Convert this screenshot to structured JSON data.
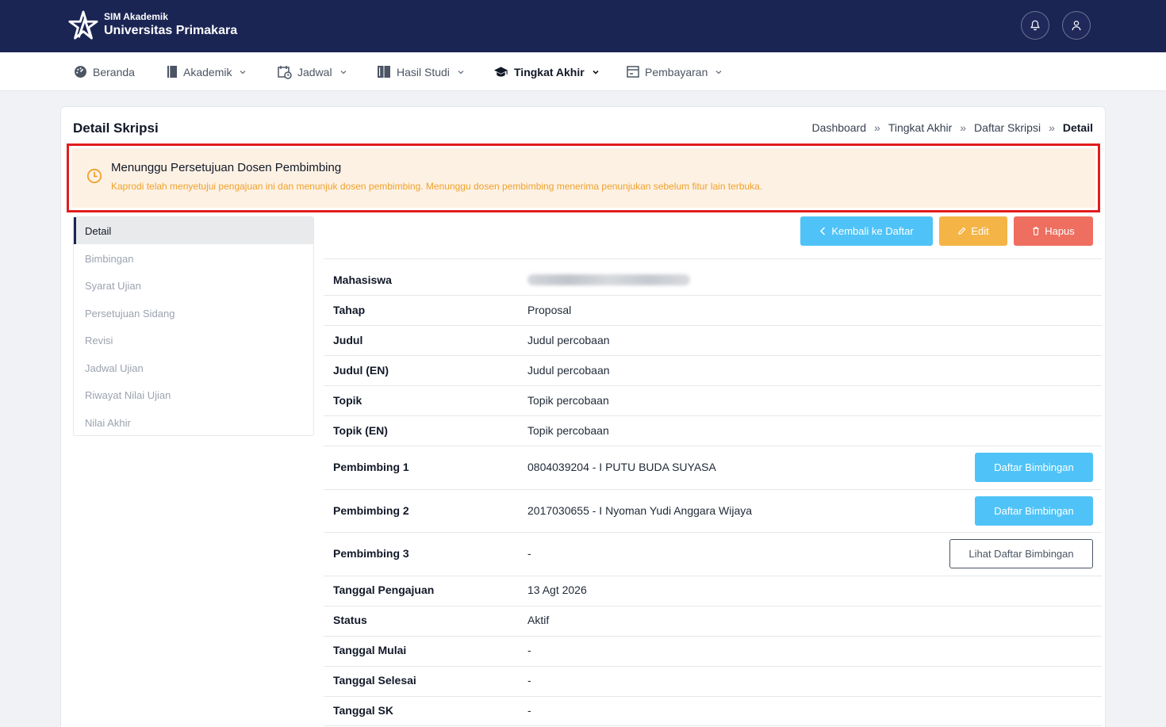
{
  "header": {
    "app_small": "SIM Akademik",
    "app_name": "Universitas Primakara"
  },
  "nav": {
    "items": [
      {
        "label": "Beranda",
        "icon": "dashboard-icon"
      },
      {
        "label": "Akademik",
        "icon": "book-icon"
      },
      {
        "label": "Jadwal",
        "icon": "calendar-clock-icon"
      },
      {
        "label": "Hasil Studi",
        "icon": "open-book-icon"
      },
      {
        "label": "Tingkat Akhir",
        "icon": "graduation-cap-icon",
        "active": true
      },
      {
        "label": "Pembayaran",
        "icon": "payment-card-icon"
      }
    ]
  },
  "page": {
    "title": "Detail Skripsi",
    "breadcrumb": [
      "Dashboard",
      "Tingkat Akhir",
      "Daftar Skripsi",
      "Detail"
    ],
    "breadcrumb_sep": "»"
  },
  "alert": {
    "title": "Menunggu Persetujuan Dosen Pembimbing",
    "text": "Kaprodi telah menyetujui pengajuan ini dan menunjuk dosen pembimbing. Menunggu dosen pembimbing menerima penunjukan sebelum fitur lain terbuka.",
    "color": "#f0a12a"
  },
  "side_menu": {
    "items": [
      "Detail",
      "Bimbingan",
      "Syarat Ujian",
      "Persetujuan Sidang",
      "Revisi",
      "Jadwal Ujian",
      "Riwayat Nilai Ujian",
      "Nilai Akhir"
    ],
    "active": "Detail"
  },
  "actions": {
    "back": "Kembali ke Daftar",
    "edit": "Edit",
    "delete": "Hapus"
  },
  "details": {
    "rows": [
      {
        "label": "Mahasiswa",
        "value": ""
      },
      {
        "label": "Tahap",
        "value": "Proposal"
      },
      {
        "label": "Judul",
        "value": "Judul percobaan"
      },
      {
        "label": "Judul (EN)",
        "value": "Judul percobaan"
      },
      {
        "label": "Topik",
        "value": "Topik percobaan"
      },
      {
        "label": "Topik (EN)",
        "value": "Topik percobaan"
      },
      {
        "label": "Pembimbing 1",
        "value": "0804039204 - I PUTU BUDA SUYASA",
        "button": "Daftar Bimbingan"
      },
      {
        "label": "Pembimbing 2",
        "value": "2017030655 - I Nyoman Yudi Anggara Wijaya",
        "button": "Daftar Bimbingan"
      },
      {
        "label": "Pembimbing 3",
        "value": "-",
        "button": "Lihat Daftar Bimbingan"
      },
      {
        "label": "Tanggal Pengajuan",
        "value": "13 Agt 2026"
      },
      {
        "label": "Status",
        "value": "Aktif"
      },
      {
        "label": "Tanggal Mulai",
        "value": "-"
      },
      {
        "label": "Tanggal Selesai",
        "value": "-"
      },
      {
        "label": "Tanggal SK",
        "value": "-"
      }
    ]
  },
  "colors": {
    "header_bg": "#1b2554",
    "primary_button": "#4fc3f7",
    "edit_button": "#f5b446",
    "delete_button": "#ee6e5f",
    "highlight_border": "#e11d1d"
  }
}
